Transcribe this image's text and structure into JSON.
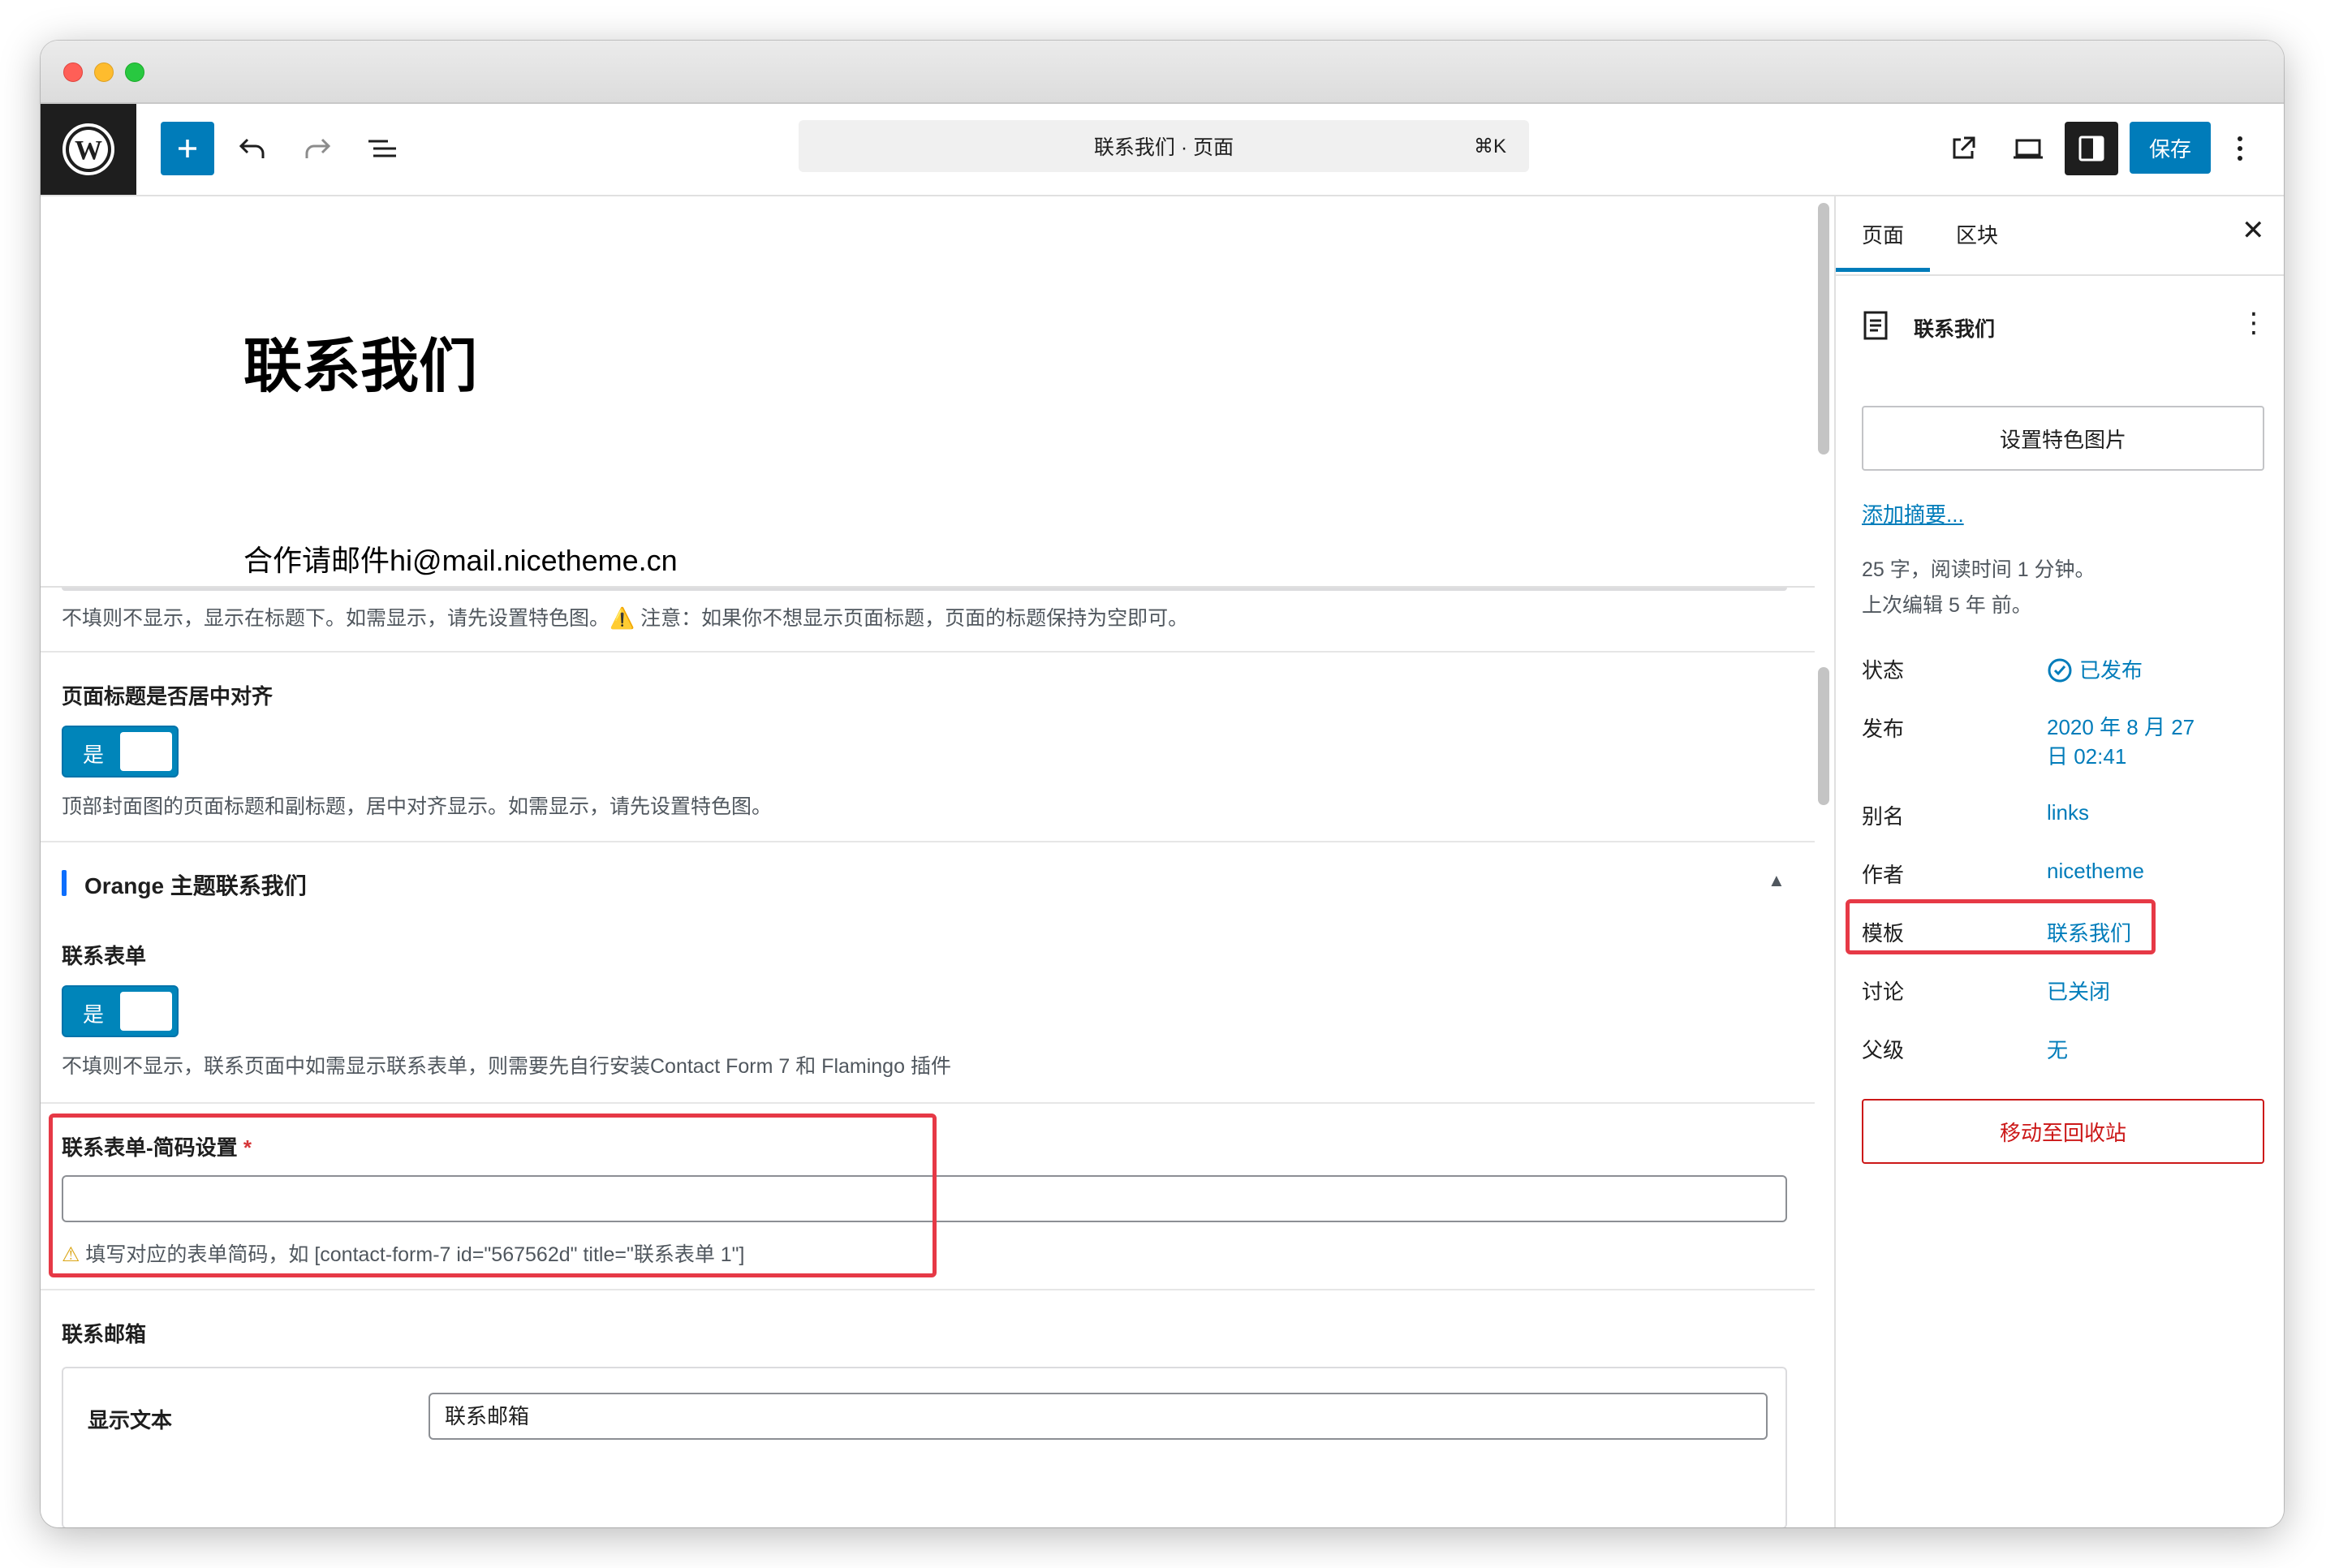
{
  "toolbar": {
    "logo_alt": "WordPress",
    "document_bar_title": "联系我们 · 页面",
    "document_bar_shortcut": "⌘K",
    "save_label": "保存",
    "icons": {
      "add": "plus-icon",
      "undo": "undo-icon",
      "redo": "redo-icon",
      "list_view": "list-view-icon",
      "view": "external-link-icon",
      "device": "desktop-preview-icon",
      "settings": "sidebar-toggle-icon",
      "more": "more-vertical-icon"
    }
  },
  "canvas": {
    "title": "联系我们",
    "paragraph": "合作请邮件hi@mail.nicetheme.cn"
  },
  "metabox": {
    "title_hint": "不填则不显示，显示在标题下。如需显示，请先设置特色图。⚠️ 注意：如果你不想显示页面标题，页面的标题保持为空即可。",
    "center_title": {
      "label": "页面标题是否居中对齐",
      "toggle_label": "是",
      "hint": "顶部封面图的页面标题和副标题，居中对齐显示。如需显示，请先设置特色图。"
    },
    "section": {
      "heading": "Orange 主题联系我们"
    },
    "contact_form": {
      "label": "联系表单",
      "toggle_label": "是",
      "hint": "不填则不显示，联系页面中如需显示联系表单，则需要先自行安装Contact Form 7 和 Flamingo 插件"
    },
    "shortcode": {
      "label": "联系表单-简码设置",
      "required": "*",
      "value": "",
      "hint": "填写对应的表单简码，如 [contact-form-7 id=\"567562d\" title=\"联系表单 1\"]",
      "warn_icon": "⚠"
    },
    "contact_email": {
      "label": "联系邮箱",
      "row_label": "显示文本",
      "row_value": "联系邮箱"
    }
  },
  "sidebar": {
    "tabs": [
      "页面",
      "区块"
    ],
    "doc_title": "联系我们",
    "featured_image_button": "设置特色图片",
    "excerpt_link": "添加摘要...",
    "word_count": "25 字，阅读时间 1 分钟。",
    "last_edited": "上次编辑 5 年 前。",
    "rows": [
      {
        "label": "状态",
        "value": "已发布"
      },
      {
        "label": "发布",
        "value": "2020 年 8 月 27\n日 02:41"
      },
      {
        "label": "别名",
        "value": "links"
      },
      {
        "label": "作者",
        "value": "nicetheme"
      },
      {
        "label": "模板",
        "value": "联系我们"
      },
      {
        "label": "讨论",
        "value": "已关闭"
      },
      {
        "label": "父级",
        "value": "无"
      }
    ],
    "trash_button": "移动至回收站"
  },
  "colors": {
    "accent": "#007cba",
    "highlight": "#e63946",
    "danger": "#cc1818"
  }
}
